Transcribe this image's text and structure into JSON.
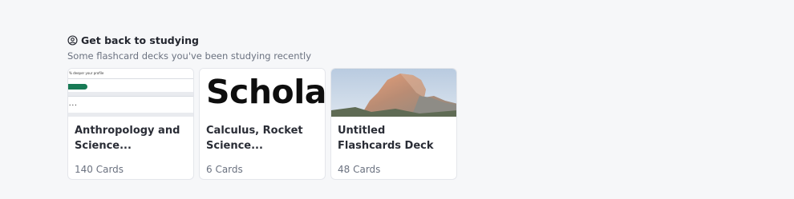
{
  "section": {
    "title": "Get back to studying",
    "subtitle": "Some flashcard decks you've been studying recently"
  },
  "cards": [
    {
      "title": "Anthropology and Science...",
      "count": "140 Cards",
      "thumb_lines": [
        "% deeper your profile",
        "• • •"
      ]
    },
    {
      "title": "Calculus, Rocket Science...",
      "count": "6 Cards",
      "thumb_word": "Scholar"
    },
    {
      "title": "Untitled Flashcards Deck",
      "count": "48 Cards"
    }
  ],
  "colors": {
    "background": "#f6f7f9",
    "accent_green": "#187a55"
  }
}
